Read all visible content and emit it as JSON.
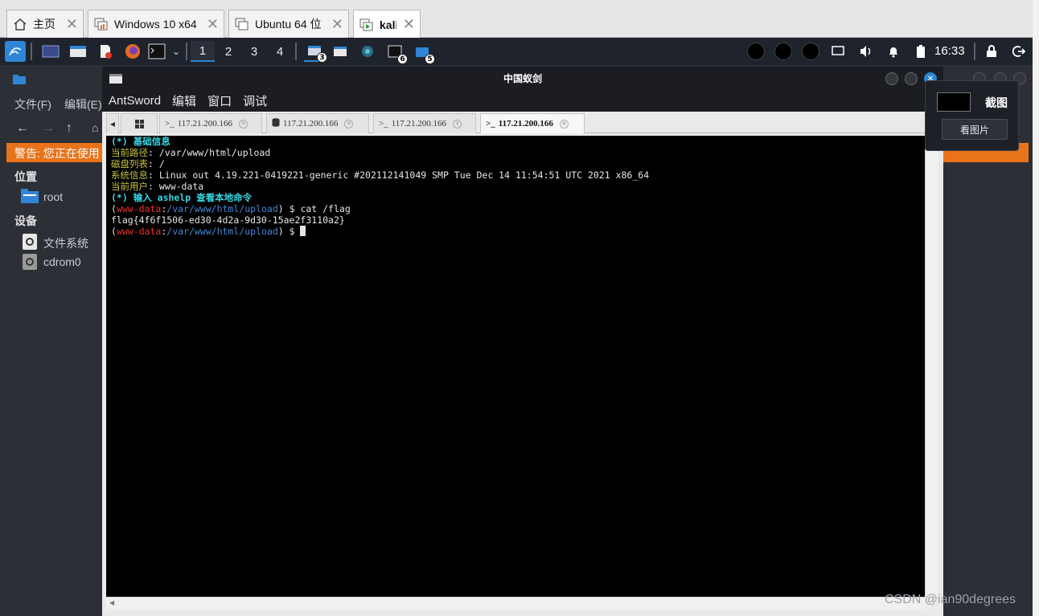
{
  "vm_tabs": [
    {
      "label": "主页",
      "icon": "home-icon"
    },
    {
      "label": "Windows 10 x64",
      "icon": "vm-icon"
    },
    {
      "label": "Ubuntu 64 位",
      "icon": "vm-icon"
    },
    {
      "label": "kali",
      "icon": "vm-running-icon"
    }
  ],
  "panel": {
    "workspaces": [
      "1",
      "2",
      "3",
      "4"
    ],
    "badges": [
      "3",
      "6",
      "5"
    ],
    "clock": "16:33"
  },
  "file_manager": {
    "menu": [
      "文件(F)",
      "编辑(E)"
    ],
    "warning": "警告: 您正在使用",
    "places_header": "位置",
    "places": [
      "root"
    ],
    "devices_header": "设备",
    "devices": [
      "文件系统",
      "cdrom0"
    ]
  },
  "antsword": {
    "title": "中国蚁剑",
    "menu": [
      "AntSword",
      "编辑",
      "窗口",
      "调试"
    ],
    "tabs": [
      "117.21.200.166",
      "117.21.200.166",
      "117.21.200.166",
      "117.21.200.166"
    ],
    "terminal": {
      "info_header": "(*) 基础信息",
      "path_label": "当前路径",
      "path_value": ": /var/www/html/upload",
      "disk_label": "磁盘列表",
      "disk_value": ": /",
      "sys_label": "系统信息",
      "sys_value": ": Linux out 4.19.221-0419221-generic #202112141049 SMP Tue Dec 14 11:54:51 UTC 2021 x86_64",
      "user_label": "当前用户",
      "user_value": ": www-data",
      "help_line": "(*) 输入 ashelp 查看本地命令",
      "prompt_user": "www-data",
      "prompt_path": "/var/www/html/upload",
      "command": ") $ cat /flag",
      "output": "flag{4f6f1506-ed30-4d2a-9d30-15ae2f3110a2}",
      "prompt_end": ") $ "
    }
  },
  "screenshot_popup": {
    "title": "截图",
    "button": "看图片"
  },
  "watermark": "CSDN @ian90degrees"
}
